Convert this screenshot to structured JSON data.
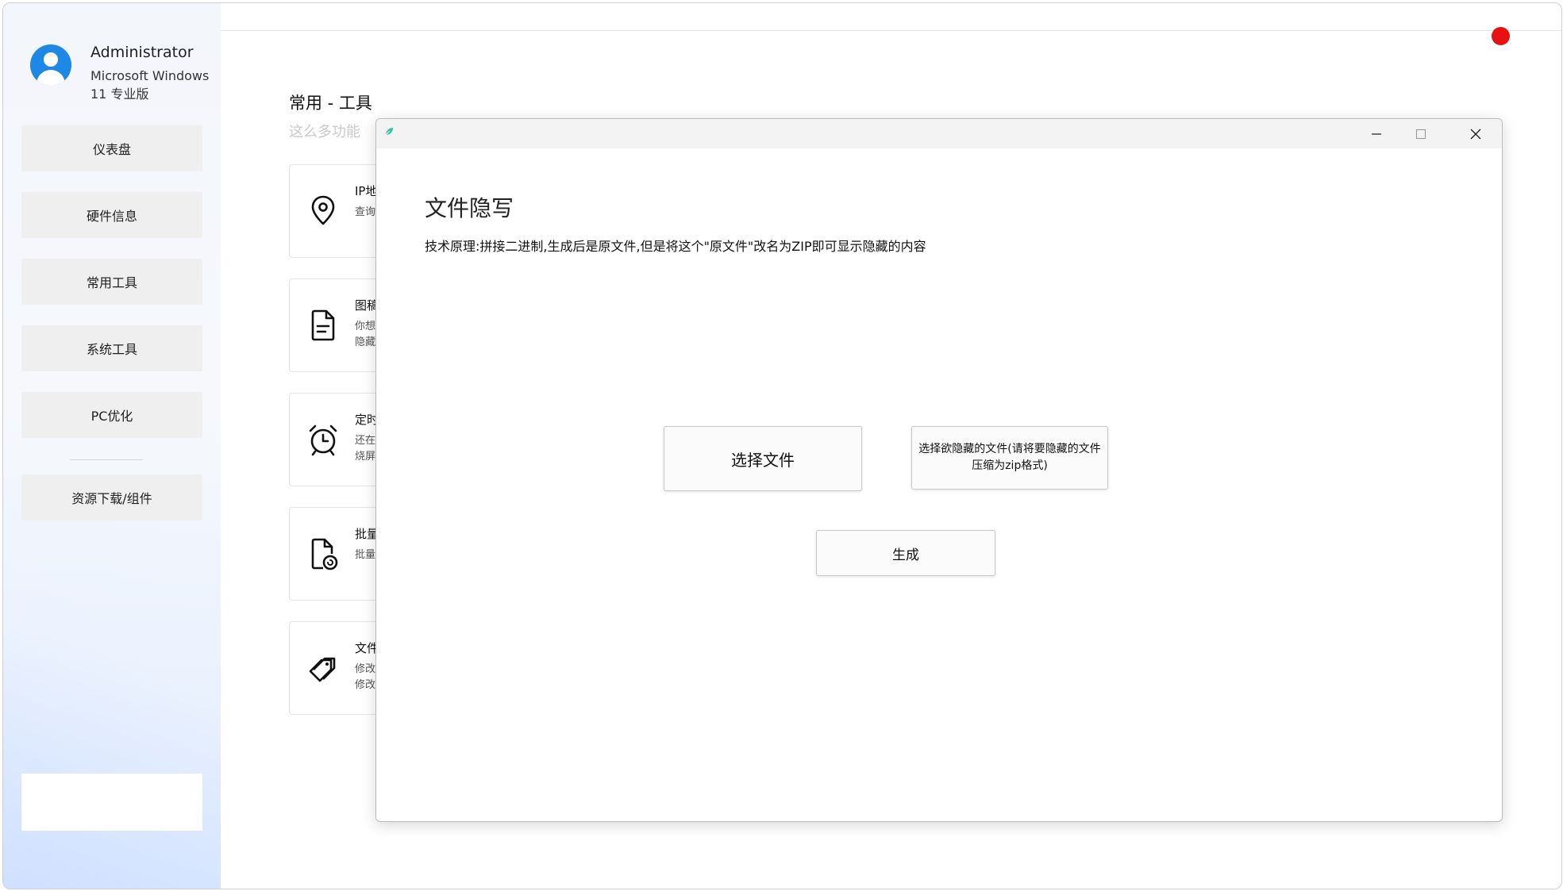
{
  "profile": {
    "name": "Administrator",
    "os": "Microsoft Windows 11 专业版"
  },
  "sidebar": {
    "items": [
      {
        "label": "仪表盘"
      },
      {
        "label": "硬件信息"
      },
      {
        "label": "常用工具"
      },
      {
        "label": "系统工具"
      },
      {
        "label": "PC优化"
      },
      {
        "label": "资源下载/组件"
      }
    ]
  },
  "main": {
    "title": "常用 - 工具",
    "subtitle": "这么多功能",
    "cards": [
      {
        "icon": "location-pin-icon",
        "title": "IP地",
        "desc1": "查询",
        "desc2": ""
      },
      {
        "icon": "document-icon",
        "title": "图稿",
        "desc1": "你想",
        "desc2": "隐藏"
      },
      {
        "icon": "alarm-clock-icon",
        "title": "定时",
        "desc1": "还在",
        "desc2": "烧屏"
      },
      {
        "icon": "file-refresh-icon",
        "title": "批量",
        "desc1": "批量",
        "desc2": ""
      },
      {
        "icon": "tag-icon",
        "title": "文件",
        "desc1": "修改",
        "desc2": "修改"
      }
    ]
  },
  "status": {
    "dot_color": "#e81010"
  },
  "dialog": {
    "title": "文件隐写",
    "description": "技术原理:拼接二进制,生成后是原文件,但是将这个\"原文件\"改名为ZIP即可显示隐藏的内容",
    "select_file_label": "选择文件",
    "select_hidden_label": "选择欲隐藏的文件(请将要隐藏的文件压缩为zip格式)",
    "generate_label": "生成",
    "window_controls": [
      "minimize-icon",
      "maximize-icon",
      "close-icon"
    ]
  }
}
